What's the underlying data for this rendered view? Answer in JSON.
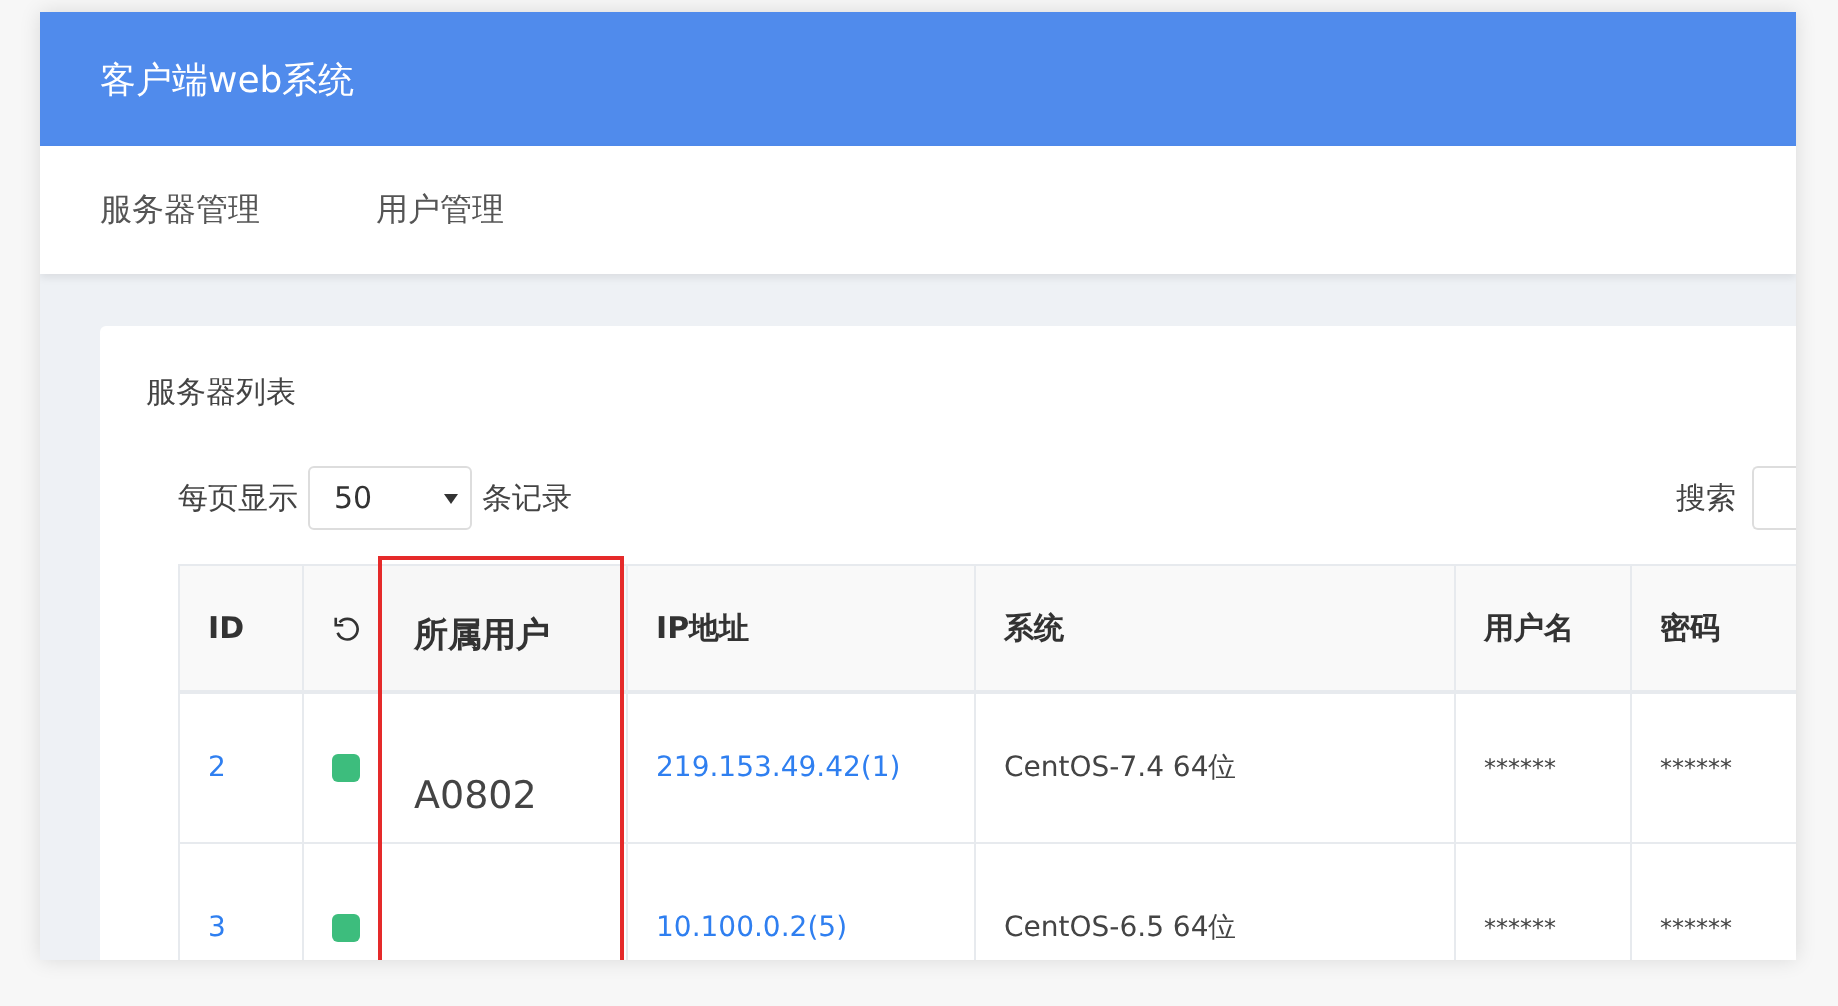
{
  "header": {
    "title": "客户端web系统"
  },
  "nav": [
    {
      "label": "服务器管理",
      "selected": false
    },
    {
      "label": "用户管理",
      "selected": false
    }
  ],
  "card": {
    "title": "服务器列表",
    "page_size": {
      "prefix": "每页显示",
      "value": "50",
      "suffix": "条记录"
    },
    "search": {
      "label": "搜索"
    },
    "table": {
      "columns": [
        {
          "label": "ID",
          "kind": "text"
        },
        {
          "kind": "refresh"
        },
        {
          "label": "所属用户",
          "kind": "text",
          "highlighted": true
        },
        {
          "label": "IP地址",
          "kind": "text"
        },
        {
          "label": "系统",
          "kind": "text"
        },
        {
          "label": "用户名",
          "kind": "text"
        },
        {
          "label": "密码",
          "kind": "text"
        }
      ],
      "rows": [
        {
          "id": "2",
          "color": "#3dbd7d",
          "owner": "A0802",
          "ip": "219.153.49.42(1)",
          "system": "CentOS-7.4 64位",
          "username": "******",
          "password": "******"
        },
        {
          "id": "3",
          "color": "#3dbd7d",
          "ip": "10.100.0.2(5)",
          "system": "CentOS-6.5 64位",
          "username": "******",
          "password": "******"
        }
      ]
    }
  }
}
